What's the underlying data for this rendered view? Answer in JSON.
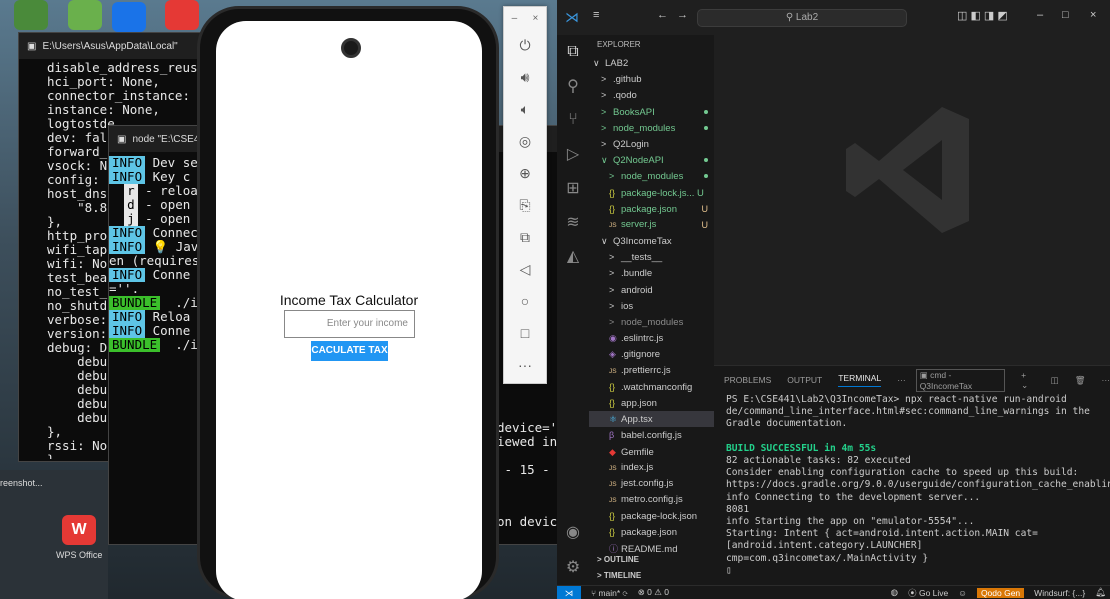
{
  "desktop": {
    "icons": [
      {
        "label": "reenshot..."
      },
      {
        "label": "WPS Office"
      }
    ]
  },
  "terminal1": {
    "tab_title": "E:\\Users\\Asus\\AppData\\Local\"",
    "lines": [
      "disable_address_reuse:",
      "hci_port: None,",
      "connector_instance: No",
      "instance: None,",
      "logtostde",
      "dev: fals",
      "forward_",
      "vsock: No",
      "config: N",
      "host_dns:",
      "    \"8.8.",
      "},",
      "http_prox",
      "wifi_tap:",
      "wifi: Nor",
      "test_beac",
      "no_test_b",
      "no_shutdo",
      "verbose: ",
      "version: ",
      "debug: De",
      "    debug",
      "    debug",
      "    debug",
      "    debug",
      "    debug",
      "},",
      "rssi: Nor",
      "}"
    ]
  },
  "terminal2": {
    "tab_title": "node \"E:\\CSE4",
    "info": "INFO",
    "bundle": "BUNDLE",
    "rows": [
      {
        "tag": "INFO",
        "text": " Dev se"
      },
      {
        "tag": "INFO",
        "text": " Key c"
      },
      {
        "tag": "",
        "text": ""
      },
      {
        "tag": "key",
        "key": "r",
        "text": " - reloa"
      },
      {
        "tag": "key",
        "key": "d",
        "text": " - open"
      },
      {
        "tag": "key",
        "key": "j",
        "text": " - open"
      },
      {
        "tag": "",
        "text": ""
      },
      {
        "tag": "INFO",
        "text": " Connec"
      },
      {
        "tag": "INFO",
        "text": " 💡 Jav"
      },
      {
        "tag": "",
        "text": "en (requires"
      },
      {
        "tag": "INFO",
        "text": " Conne"
      },
      {
        "tag": "",
        "text": "=''."
      },
      {
        "tag": "BUNDLE",
        "text": "  ./i"
      },
      {
        "tag": "INFO",
        "text": " Reloa"
      },
      {
        "tag": "INFO",
        "text": " Conne"
      },
      {
        "tag": "BUNDLE",
        "text": "  ./i"
      }
    ],
    "right_fragments": [
      "device='s",
      "iewed in",
      " - 15 -",
      "on devic"
    ]
  },
  "app": {
    "title": "Income Tax Calculator",
    "income_placeholder": "Enter your income",
    "button_label": "CACULATE TAX"
  },
  "emulator": {
    "min": "–",
    "close": "×",
    "buttons": [
      "power-icon",
      "volume-up-icon",
      "volume-down-icon",
      "camera-icon",
      "zoom-in-icon",
      "rotate-icon",
      "fold-icon",
      "back-icon",
      "home-icon",
      "overview-icon",
      "more-icon"
    ]
  },
  "vscode": {
    "search": "Lab2",
    "explorer_title": "EXPLORER",
    "tree": [
      {
        "label": "LAB2",
        "indent": 0,
        "arrow": "∨",
        "color": "#cccccc"
      },
      {
        "label": ".github",
        "indent": 1,
        "arrow": ">",
        "color": "#cccccc"
      },
      {
        "label": ".qodo",
        "indent": 1,
        "arrow": ">",
        "color": "#cccccc"
      },
      {
        "label": "BooksAPI",
        "indent": 1,
        "arrow": ">",
        "color": "#73c991",
        "dot": true
      },
      {
        "label": "node_modules",
        "indent": 1,
        "arrow": ">",
        "color": "#73c991",
        "dot": true
      },
      {
        "label": "Q2Login",
        "indent": 1,
        "arrow": ">",
        "color": "#cccccc"
      },
      {
        "label": "Q2NodeAPI",
        "indent": 1,
        "arrow": "∨",
        "color": "#73c991",
        "dot": true
      },
      {
        "label": "node_modules",
        "indent": 2,
        "arrow": ">",
        "color": "#73c991",
        "dot": true
      },
      {
        "label": "package-lock.js... U",
        "indent": 2,
        "icon": "{}",
        "color": "#73c991"
      },
      {
        "label": "package.json",
        "indent": 2,
        "icon": "{}",
        "color": "#73c991",
        "badge": "U"
      },
      {
        "label": "server.js",
        "indent": 2,
        "icon": "JS",
        "color": "#73c991",
        "badge": "U"
      },
      {
        "label": "Q3IncomeTax",
        "indent": 1,
        "arrow": "∨",
        "color": "#cccccc"
      },
      {
        "label": "__tests__",
        "indent": 2,
        "arrow": ">",
        "color": "#cccccc"
      },
      {
        "label": ".bundle",
        "indent": 2,
        "arrow": ">",
        "color": "#cccccc"
      },
      {
        "label": "android",
        "indent": 2,
        "arrow": ">",
        "color": "#cccccc"
      },
      {
        "label": "ios",
        "indent": 2,
        "arrow": ">",
        "color": "#cccccc"
      },
      {
        "label": "node_modules",
        "indent": 2,
        "arrow": ">",
        "color": "#8b8b8b"
      },
      {
        "label": ".eslintrc.js",
        "indent": 2,
        "icon": "◉",
        "color": "#cccccc"
      },
      {
        "label": ".gitignore",
        "indent": 2,
        "icon": "◈",
        "color": "#cccccc"
      },
      {
        "label": ".prettierrc.js",
        "indent": 2,
        "icon": "JS",
        "color": "#cccccc"
      },
      {
        "label": ".watchmanconfig",
        "indent": 2,
        "icon": "{}",
        "color": "#cccccc"
      },
      {
        "label": "app.json",
        "indent": 2,
        "icon": "{}",
        "color": "#cccccc"
      },
      {
        "label": "App.tsx",
        "indent": 2,
        "icon": "⚛",
        "color": "#cccccc"
      },
      {
        "label": "babel.config.js",
        "indent": 2,
        "icon": "β",
        "color": "#cccccc"
      },
      {
        "label": "Gemfile",
        "indent": 2,
        "icon": "◆",
        "color": "#cccccc"
      },
      {
        "label": "index.js",
        "indent": 2,
        "icon": "JS",
        "color": "#cccccc"
      },
      {
        "label": "jest.config.js",
        "indent": 2,
        "icon": "JS",
        "color": "#cccccc"
      },
      {
        "label": "metro.config.js",
        "indent": 2,
        "icon": "JS",
        "color": "#cccccc"
      },
      {
        "label": "package-lock.json",
        "indent": 2,
        "icon": "{}",
        "color": "#cccccc"
      },
      {
        "label": "package.json",
        "indent": 2,
        "icon": "{}",
        "color": "#cccccc"
      },
      {
        "label": "README.md",
        "indent": 2,
        "icon": "ⓘ",
        "color": "#cccccc"
      }
    ],
    "outline": "OUTLINE",
    "timeline": "TIMELINE",
    "panel_tabs": [
      "PROBLEMS",
      "OUTPUT",
      "TERMINAL",
      "···"
    ],
    "terminal_name": "cmd - Q3IncomeTax",
    "terminal_lines": [
      {
        "text": "PS E:\\CSE441\\Lab2\\Q3IncomeTax> npx react-native run-android",
        "color": "#cccccc"
      },
      {
        "text": "de/command_line_interface.html#sec:command_line_warnings in the Gradle documentation.",
        "color": "#cccccc"
      },
      {
        "text": "",
        "color": "#cccccc"
      },
      {
        "text": "BUILD SUCCESSFUL in 4m 55s",
        "color": "#23d18b"
      },
      {
        "text": "82 actionable tasks: 82 executed",
        "color": "#cccccc"
      },
      {
        "text": "Consider enabling configuration cache to speed up this build: https://docs.gradle.org/9.0.0/userguide/configuration_cache_enabling.html",
        "color": "#cccccc"
      },
      {
        "text": "info Connecting to the development server...",
        "color": "#cccccc"
      },
      {
        "text": "8081",
        "color": "#cccccc"
      },
      {
        "text": "info Starting the app on \"emulator-5554\"...",
        "color": "#cccccc"
      },
      {
        "text": "Starting: Intent { act=android.intent.action.MAIN cat=[android.intent.category.LAUNCHER] cmp=com.q3incometax/.MainActivity }",
        "color": "#cccccc"
      },
      {
        "text": "▯",
        "color": "#cccccc"
      }
    ],
    "status": {
      "branch": "main*",
      "sync": "⟳",
      "problems": "⊗ 0 ⚠ 0",
      "golive": "Go Live",
      "qodo": "Qodo Gen",
      "windsurf": "Windsurf: {...}"
    }
  }
}
